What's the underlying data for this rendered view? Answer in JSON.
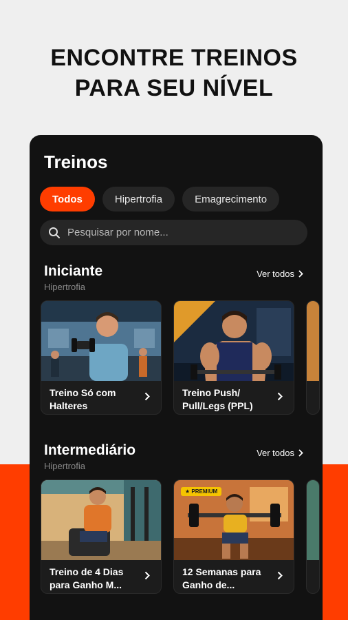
{
  "headline": {
    "line1": "ENCONTRE TREINOS",
    "line2": "PARA SEU NÍVEL"
  },
  "screen": {
    "title": "Treinos",
    "filters": [
      {
        "label": "Todos",
        "active": true
      },
      {
        "label": "Hipertrofia",
        "active": false
      },
      {
        "label": "Emagrecimento",
        "active": false
      }
    ],
    "search": {
      "placeholder": "Pesquisar por nome..."
    }
  },
  "sections": [
    {
      "title": "Iniciante",
      "subtitle": "Hipertrofia",
      "see_all": "Ver todos",
      "cards": [
        {
          "label": "Treino Só com Halteres",
          "image": "gym-dumbbell-curl-illustration"
        },
        {
          "label": "Treino Push/ Pull/Legs (PPL)",
          "image": "bodybuilder-curl-illustration"
        }
      ]
    },
    {
      "title": "Intermediário",
      "subtitle": "Hipertrofia",
      "see_all": "Ver todos",
      "cards": [
        {
          "label": "Treino de 4 Dias para Ganho M...",
          "image": "gym-machine-illustration"
        },
        {
          "label": "12 Semanas para Ganho de...",
          "image": "squat-barbell-illustration",
          "badge": "★ PREMIUM"
        }
      ]
    }
  ],
  "colors": {
    "accent": "#ff3d00",
    "background": "#efefef",
    "phone": "#121212"
  },
  "icons": [
    "search-icon",
    "chevron-right-icon"
  ]
}
